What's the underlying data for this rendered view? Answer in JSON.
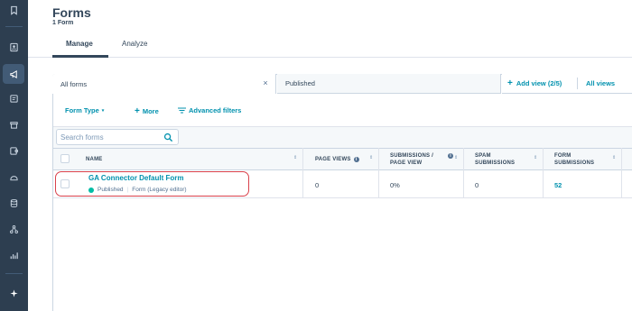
{
  "header": {
    "title": "Forms",
    "subtitle": "1 Form",
    "tabs": [
      {
        "label": "Manage",
        "active": true
      },
      {
        "label": "Analyze",
        "active": false
      }
    ]
  },
  "view_tabs": {
    "all_forms": "All forms",
    "published": "Published",
    "close_glyph": "×",
    "add_view": "Add view (2/5)",
    "add_view_icon": "+",
    "all_views": "All views"
  },
  "filters": {
    "form_type": "Form Type",
    "form_type_caret": "▾",
    "more": "More",
    "more_icon": "+",
    "advanced": "Advanced filters"
  },
  "search": {
    "placeholder": "Search forms"
  },
  "table": {
    "columns": {
      "name": "NAME",
      "page_views": "PAGE VIEWS",
      "submissions_per_view": "SUBMISSIONS / PAGE VIEW",
      "spam": "SPAM SUBMISSIONS",
      "form_submissions": "FORM SUBMISSIONS"
    },
    "info_glyph": "i",
    "sort_glyph": "⇕",
    "rows": [
      {
        "name": "GA Connector Default Form",
        "status": "Published",
        "editor": "Form (Legacy editor)",
        "meta_sep": "|",
        "page_views": "0",
        "submissions_per_view": "0%",
        "spam": "0",
        "form_submissions": "52"
      }
    ]
  },
  "colors": {
    "nav_bg": "#2d3e50",
    "link": "#0091ae",
    "text": "#33475b",
    "status_published": "#00bda5",
    "highlight_outline": "#d9414b"
  },
  "nav_icons": [
    "bookmark-icon",
    "contacts-icon",
    "marketing-icon",
    "content-icon",
    "commerce-icon",
    "service-icon",
    "automation-icon",
    "database-icon",
    "network-icon",
    "reports-icon",
    "sparkle-icon"
  ]
}
